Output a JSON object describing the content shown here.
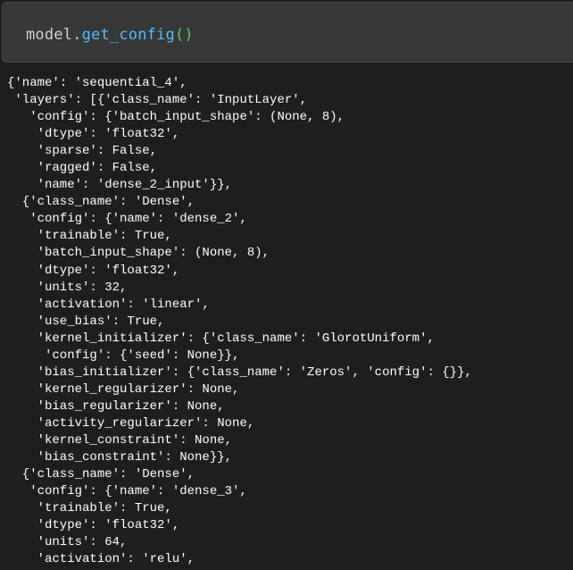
{
  "code_cell": {
    "object": "model",
    "dot": ".",
    "method": "get_config",
    "parens": "()"
  },
  "output": {
    "lines": [
      "{'name': 'sequential_4',",
      " 'layers': [{'class_name': 'InputLayer',",
      "   'config': {'batch_input_shape': (None, 8),",
      "    'dtype': 'float32',",
      "    'sparse': False,",
      "    'ragged': False,",
      "    'name': 'dense_2_input'}},",
      "  {'class_name': 'Dense',",
      "   'config': {'name': 'dense_2',",
      "    'trainable': True,",
      "    'batch_input_shape': (None, 8),",
      "    'dtype': 'float32',",
      "    'units': 32,",
      "    'activation': 'linear',",
      "    'use_bias': True,",
      "    'kernel_initializer': {'class_name': 'GlorotUniform',",
      "     'config': {'seed': None}},",
      "    'bias_initializer': {'class_name': 'Zeros', 'config': {}},",
      "    'kernel_regularizer': None,",
      "    'bias_regularizer': None,",
      "    'activity_regularizer': None,",
      "    'kernel_constraint': None,",
      "    'bias_constraint': None}},",
      "  {'class_name': 'Dense',",
      "   'config': {'name': 'dense_3',",
      "    'trainable': True,",
      "    'dtype': 'float32',",
      "    'units': 64,",
      "    'activation': 'relu',"
    ]
  }
}
